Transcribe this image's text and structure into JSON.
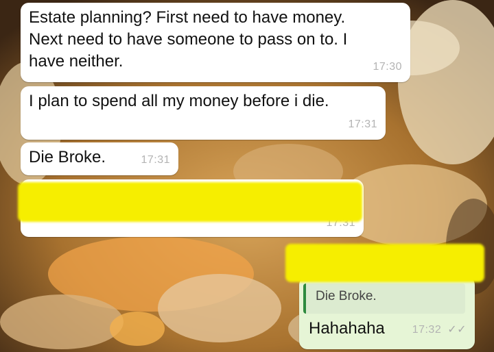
{
  "chat": {
    "messages": [
      {
        "text": "Estate planning? First need to have money. Next need to have someone to pass on to.  I have neither.",
        "time": "17:30"
      },
      {
        "text": "I plan to spend all my money before i die.",
        "time": "17:31"
      },
      {
        "text": "Die Broke.",
        "time": "17:31"
      },
      {
        "text": "",
        "time": "17:31",
        "redacted": true
      }
    ],
    "reply": {
      "quoted_text": "Die Broke.",
      "text": "Hahahaha",
      "time": "17:32",
      "status_icon": "double-check-icon"
    }
  },
  "colors": {
    "incoming_bubble": "#ffffff",
    "outgoing_bubble": "#e6f5d6",
    "redaction": "#f6ee00",
    "quote_bar": "#2e8a3e"
  }
}
